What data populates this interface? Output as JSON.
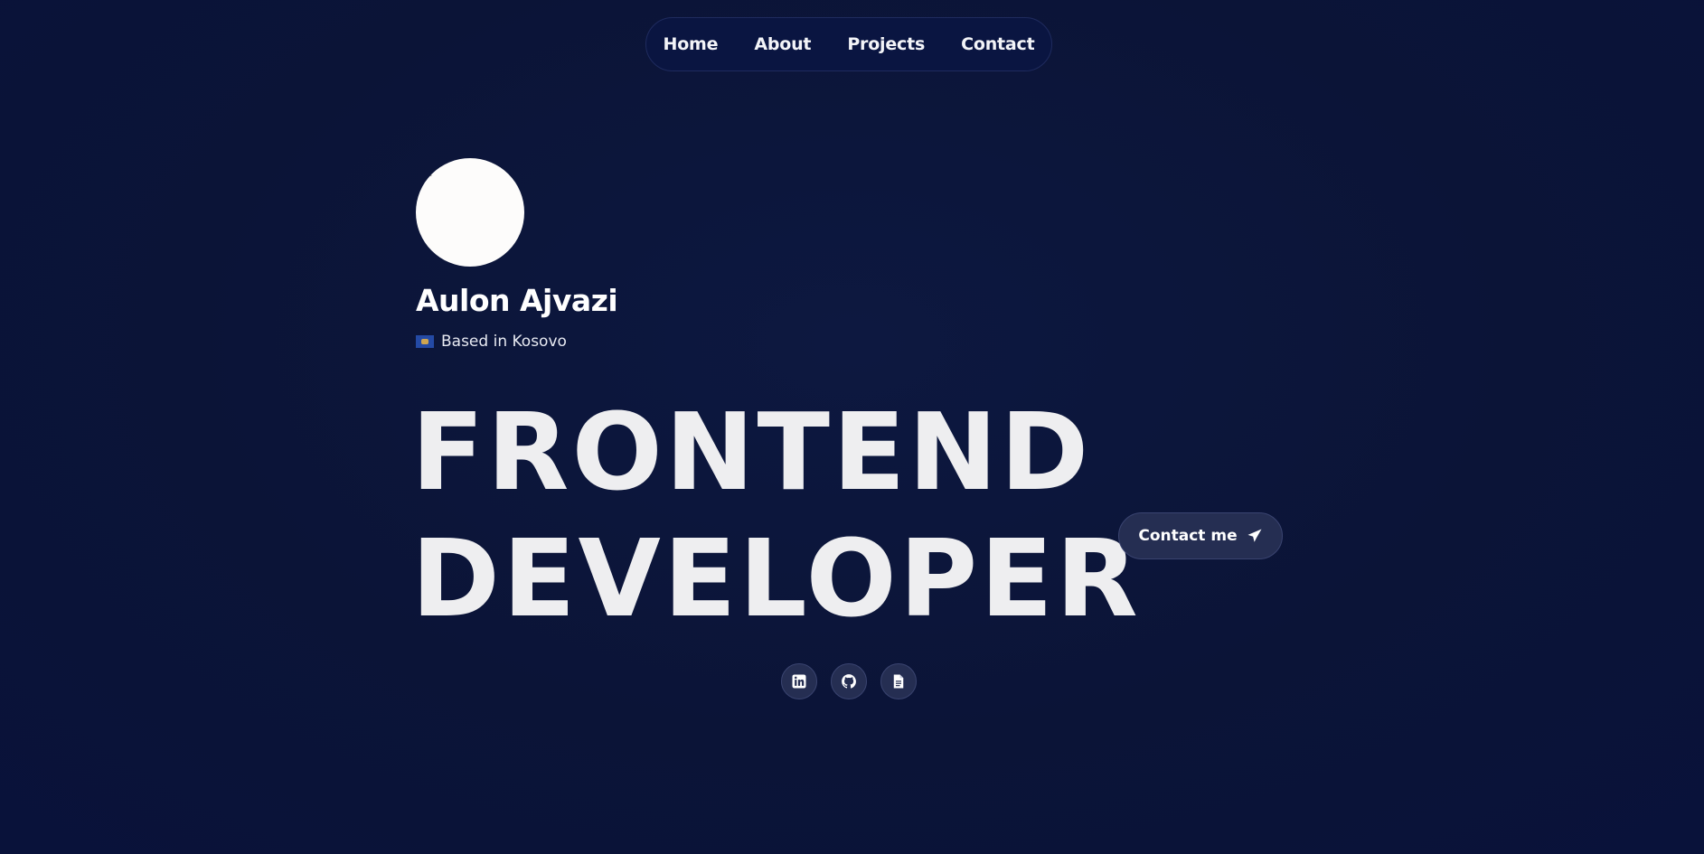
{
  "nav": {
    "items": [
      {
        "label": "Home"
      },
      {
        "label": "About"
      },
      {
        "label": "Projects"
      },
      {
        "label": "Contact"
      }
    ]
  },
  "profile": {
    "name": "Aulon Ajvazi",
    "location": "Based in Kosovo",
    "flag_icon": "kosovo-flag-icon"
  },
  "hero": {
    "line1": "FRONTEND",
    "line2": "DEVELOPER"
  },
  "cta": {
    "label": "Contact me",
    "icon": "paper-plane-icon"
  },
  "socials": [
    {
      "icon": "linkedin-icon"
    },
    {
      "icon": "github-icon"
    },
    {
      "icon": "document-icon"
    }
  ],
  "colors": {
    "background": "#0b1437",
    "nav_background": "#0a1541",
    "button_background": "#252e52",
    "text": "#ffffff",
    "headline": "#eeeef0"
  }
}
